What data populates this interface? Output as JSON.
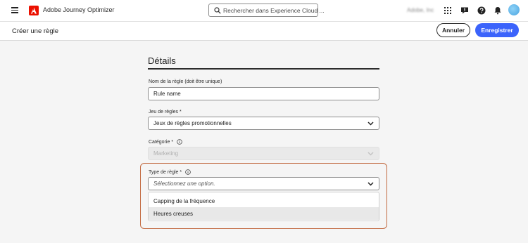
{
  "app": {
    "title": "Adobe Journey Optimizer",
    "org_name": "Adobe, Inc"
  },
  "search": {
    "placeholder": "Rechercher dans Experience Cloud ..."
  },
  "header_icons": [
    "apps-grid-icon",
    "feedback-icon",
    "help-icon",
    "notifications-bell-icon",
    "user-avatar"
  ],
  "subheader": {
    "page_title": "Créer une règle",
    "cancel_label": "Annuler",
    "save_label": "Enregistrer"
  },
  "form": {
    "section_title": "Détails",
    "rule_name": {
      "label": "Nom de la règle (doit être unique)",
      "value": "Rule name"
    },
    "rule_set": {
      "label": "Jeu de règles",
      "required_mark": "*",
      "value": "Jeux de règles promotionnelles"
    },
    "category": {
      "label": "Catégorie",
      "required_mark": "*",
      "value": "Marketing",
      "disabled": true
    },
    "rule_type": {
      "label": "Type de règle",
      "required_mark": "*",
      "placeholder": "Sélectionnez une option.",
      "options": [
        "Capping de la fréquence",
        "Heures creuses"
      ],
      "hovered_option": "Heures creuses"
    }
  },
  "colors": {
    "accent": "#3b63fb",
    "brand_red": "#eb1000",
    "highlight_border": "#c2693f"
  }
}
